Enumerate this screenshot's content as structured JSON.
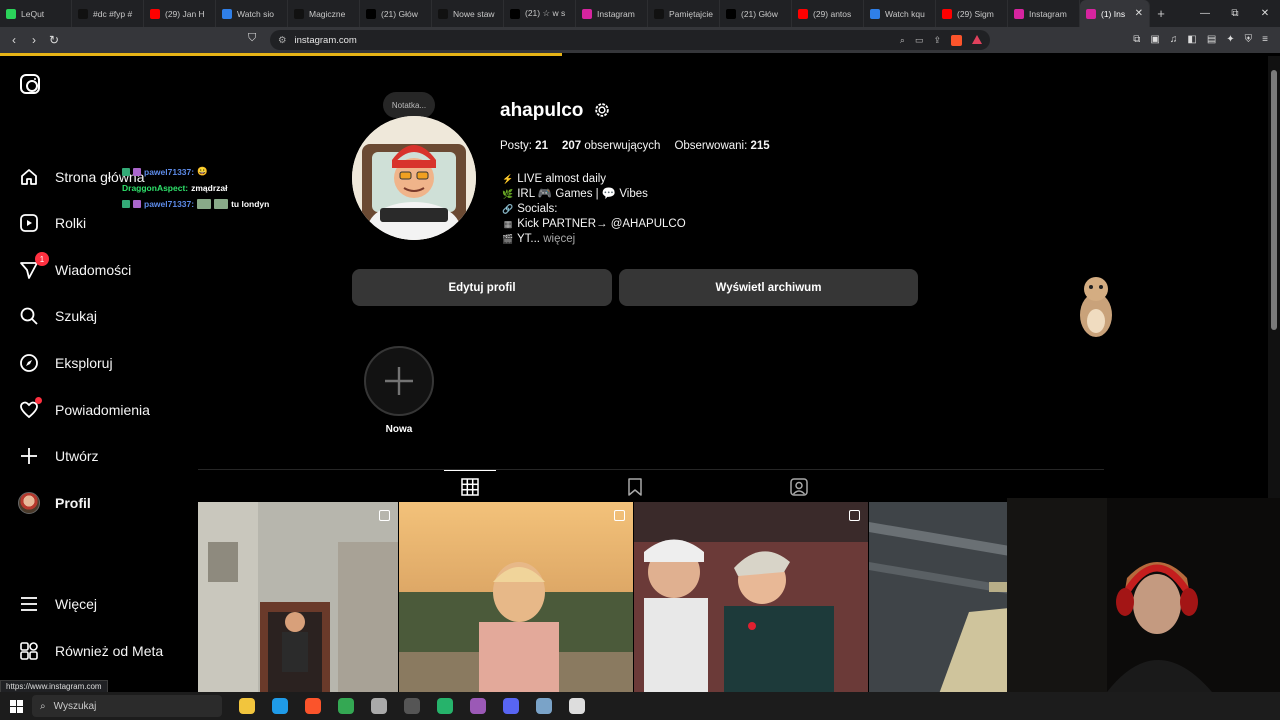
{
  "browser": {
    "tabs": [
      {
        "label": "LeQut",
        "color": "#2bd35a"
      },
      {
        "label": "#dc #fyp #",
        "color": "#111111"
      },
      {
        "label": "(29) Jan H",
        "color": "#ff0000"
      },
      {
        "label": "Watch sio",
        "color": "#2f7fe8"
      },
      {
        "label": "Magiczne",
        "color": "#111111"
      },
      {
        "label": "(21) Głów",
        "color": "#000000"
      },
      {
        "label": "Nowe staw",
        "color": "#111111"
      },
      {
        "label": "(21) ☆ w s",
        "color": "#000000"
      },
      {
        "label": "Instagram",
        "color": "#d6249f"
      },
      {
        "label": "Pamiętajcie",
        "color": "#111111"
      },
      {
        "label": "(21) Głów",
        "color": "#000000"
      },
      {
        "label": "(29) antos",
        "color": "#ff0000"
      },
      {
        "label": "Watch kqu",
        "color": "#2f7fe8"
      },
      {
        "label": "(29) Sigm",
        "color": "#ff0000"
      },
      {
        "label": "Instagram",
        "color": "#d6249f"
      }
    ],
    "active_tab": {
      "label": "(1) Ins",
      "color": "#d6249f"
    },
    "new_tab": "+",
    "window_controls": [
      "—",
      "⧉",
      "✕"
    ],
    "url": "instagram.com",
    "status_url": "https://www.instagram.com"
  },
  "nav": {
    "items": [
      {
        "label": "Strona główna",
        "icon": "home-icon"
      },
      {
        "label": "Rolki",
        "icon": "reels-icon"
      },
      {
        "label": "Wiadomości",
        "icon": "messages-icon",
        "badge": "1"
      },
      {
        "label": "Szukaj",
        "icon": "search-icon"
      },
      {
        "label": "Eksploruj",
        "icon": "explore-icon"
      },
      {
        "label": "Powiadomienia",
        "icon": "heart-icon"
      },
      {
        "label": "Utwórz",
        "icon": "plus-icon"
      },
      {
        "label": "Profil",
        "icon": "avatar"
      }
    ],
    "more_label": "Więcej",
    "meta_label": "Również od Meta"
  },
  "chat_overlay": {
    "lines": [
      {
        "user": "pawel71337:",
        "msg": "😀"
      },
      {
        "user": "DraggonAspect:",
        "msg": "zmądrzał"
      },
      {
        "user": "pawel71337:",
        "msg": "tu londyn"
      }
    ]
  },
  "profile": {
    "note": "Notatka...",
    "username": "ahapulco",
    "posts_label": "Posty:",
    "posts_count": "21",
    "followers_count": "207",
    "followers_label": "obserwujących",
    "following_label": "Obserwowani:",
    "following_count": "215",
    "bio": [
      {
        "emoji": "⚡",
        "text": "LIVE almost daily"
      },
      {
        "emoji": "🌿",
        "text": "IRL 🎮 Games | 💬 Vibes"
      },
      {
        "emoji": "🔗",
        "text": "Socials:"
      },
      {
        "emoji": "▦",
        "text": "Kick PARTNER→ @AHAPULCO"
      },
      {
        "emoji": "🎬",
        "text": "YT..."
      }
    ],
    "more": "więcej",
    "edit_button": "Edytuj profil",
    "archive_button": "Wyświetl archiwum",
    "new_story_label": "Nowa"
  },
  "taskbar": {
    "search_label": "Wyszukaj",
    "icons": [
      {
        "name": "file-explorer-icon",
        "color": "#f2c53d"
      },
      {
        "name": "edge-icon",
        "color": "#1f9be8"
      },
      {
        "name": "brave-icon",
        "color": "#fb542b"
      },
      {
        "name": "chrome-icon",
        "color": "#34a853"
      },
      {
        "name": "app-icon",
        "color": "#aaaaaa"
      },
      {
        "name": "obs-icon",
        "color": "#555555"
      },
      {
        "name": "play-icon",
        "color": "#26b36b"
      },
      {
        "name": "app-icon",
        "color": "#9b59b6"
      },
      {
        "name": "discord-icon",
        "color": "#5865f2"
      },
      {
        "name": "app-icon",
        "color": "#7aa3c8"
      },
      {
        "name": "app-icon",
        "color": "#dddddd"
      }
    ]
  }
}
